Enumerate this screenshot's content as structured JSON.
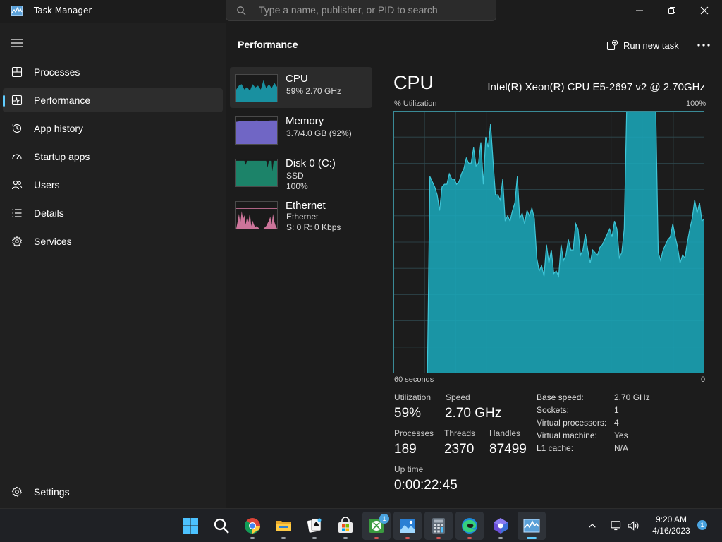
{
  "window": {
    "title": "Task Manager",
    "search_placeholder": "Type a name, publisher, or PID to search"
  },
  "sidebar": {
    "items": [
      {
        "label": "Processes",
        "icon": "processes-grid-icon"
      },
      {
        "label": "Performance",
        "icon": "performance-chart-icon",
        "active": true
      },
      {
        "label": "App history",
        "icon": "history-clock-icon"
      },
      {
        "label": "Startup apps",
        "icon": "startup-gauge-icon"
      },
      {
        "label": "Users",
        "icon": "users-icon"
      },
      {
        "label": "Details",
        "icon": "details-list-icon"
      },
      {
        "label": "Services",
        "icon": "services-puzzle-icon"
      }
    ],
    "settings_label": "Settings"
  },
  "main": {
    "title": "Performance",
    "run_new_task": "Run new task"
  },
  "resources": [
    {
      "name": "CPU",
      "sub1": "59%  2.70 GHz",
      "sub2": "",
      "color": "#1aa6b8",
      "active": true
    },
    {
      "name": "Memory",
      "sub1": "3.7/4.0 GB (92%)",
      "sub2": "",
      "color": "#7a6fd8"
    },
    {
      "name": "Disk 0 (C:)",
      "sub1": "SSD",
      "sub2": "100%",
      "color": "#1d8f72"
    },
    {
      "name": "Ethernet",
      "sub1": "Ethernet",
      "sub2": "S: 0 R: 0 Kbps",
      "color": "#e07ea8"
    }
  ],
  "detail": {
    "title": "CPU",
    "model": "Intel(R) Xeon(R) CPU E5-2697 v2 @ 2.70GHz",
    "y_label": "% Utilization",
    "y_max_label": "100%",
    "x_left_label": "60 seconds",
    "x_right_label": "0",
    "stats": {
      "utilization_label": "Utilization",
      "utilization": "59%",
      "speed_label": "Speed",
      "speed": "2.70 GHz",
      "processes_label": "Processes",
      "processes": "189",
      "threads_label": "Threads",
      "threads": "2370",
      "handles_label": "Handles",
      "handles": "87499",
      "uptime_label": "Up time",
      "uptime": "0:00:22:45"
    },
    "specs": [
      {
        "label": "Base speed:",
        "value": "2.70 GHz"
      },
      {
        "label": "Sockets:",
        "value": "1"
      },
      {
        "label": "Virtual processors:",
        "value": "4"
      },
      {
        "label": "Virtual machine:",
        "value": "Yes"
      },
      {
        "label": "L1 cache:",
        "value": "N/A"
      }
    ]
  },
  "cpu_history": [
    0,
    0,
    0,
    0,
    0,
    0,
    0,
    0,
    0,
    0,
    0,
    0,
    0,
    0,
    0,
    75,
    73,
    71,
    68,
    62,
    71,
    72,
    72,
    76,
    74,
    74,
    72,
    73,
    76,
    78,
    82,
    80,
    80,
    86,
    79,
    80,
    88,
    72,
    90,
    86,
    95,
    81,
    68,
    68,
    66,
    74,
    58,
    60,
    58,
    62,
    65,
    75,
    59,
    61,
    57,
    62,
    60,
    63,
    59,
    44,
    39,
    41,
    37,
    49,
    42,
    47,
    38,
    39,
    37,
    49,
    43,
    45,
    51,
    47,
    47,
    57,
    55,
    45,
    47,
    53,
    47,
    42,
    47,
    46,
    45,
    48,
    49,
    51,
    53,
    55,
    52,
    58,
    55,
    44,
    46,
    55,
    100,
    100,
    100,
    100,
    100,
    100,
    100,
    100,
    100,
    100,
    100,
    100,
    100,
    46,
    43,
    47,
    49,
    51,
    52,
    57,
    52,
    48,
    42,
    45,
    44,
    50,
    55,
    59,
    66,
    61,
    65,
    58,
    59
  ],
  "chart_data": {
    "type": "area",
    "title": "CPU",
    "xlabel": "60 seconds",
    "ylabel": "% Utilization",
    "ylim": [
      0,
      100
    ],
    "x_range": [
      60,
      0
    ],
    "color": "#1aa6b8"
  },
  "taskbar": {
    "apps": [
      {
        "icon": "windows-start-icon"
      },
      {
        "icon": "search-icon"
      },
      {
        "icon": "chrome-icon",
        "running": true
      },
      {
        "icon": "file-explorer-icon",
        "running": true
      },
      {
        "icon": "solitaire-icon",
        "running": true
      },
      {
        "icon": "microsoft-store-icon",
        "running": true
      },
      {
        "icon": "xbox-icon",
        "running": true,
        "badge": "1"
      },
      {
        "icon": "photos-icon",
        "running": true
      },
      {
        "icon": "calculator-icon",
        "running": true
      },
      {
        "icon": "edge-icon",
        "running": true
      },
      {
        "icon": "copilot-icon",
        "running": true
      },
      {
        "icon": "task-manager-icon",
        "running": true,
        "active": true
      }
    ],
    "time": "9:20 AM",
    "date": "4/16/2023",
    "notifications": "1"
  }
}
